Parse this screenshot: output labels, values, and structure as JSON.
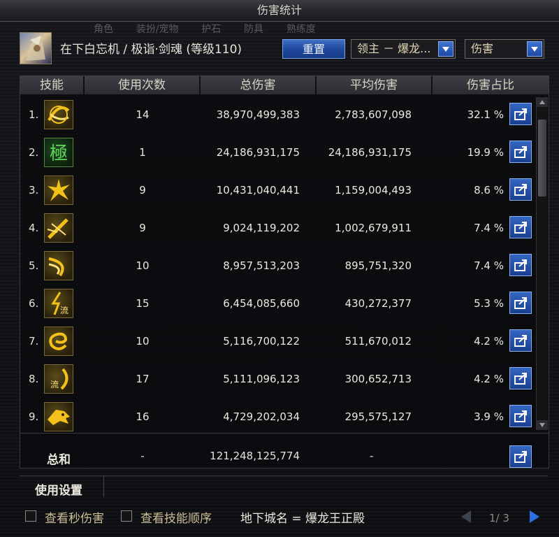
{
  "window": {
    "title": "伤害统计"
  },
  "background_tabs": [
    "角色",
    "装扮/宠物",
    "护石",
    "防具",
    "熟练度"
  ],
  "header": {
    "character": "在下白忘机 / 极诣·剑魂 (等级110)",
    "reset_label": "重置",
    "target_select": "领主 － 爆龙...",
    "metric_select": "伤害"
  },
  "columns": [
    "技能",
    "使用次数",
    "总伤害",
    "平均伤害",
    "伤害占比"
  ],
  "rows": [
    {
      "index": "1.",
      "uses": "14",
      "total": "38,970,499,383",
      "avg": "2,783,607,098",
      "pct": "32.1 %"
    },
    {
      "index": "2.",
      "uses": "1",
      "total": "24,186,931,175",
      "avg": "24,186,931,175",
      "pct": "19.9 %"
    },
    {
      "index": "3.",
      "uses": "9",
      "total": "10,431,040,441",
      "avg": "1,159,004,493",
      "pct": "8.6 %"
    },
    {
      "index": "4.",
      "uses": "9",
      "total": "9,024,119,202",
      "avg": "1,002,679,911",
      "pct": "7.4 %"
    },
    {
      "index": "5.",
      "uses": "10",
      "total": "8,957,513,203",
      "avg": "895,751,320",
      "pct": "7.4 %"
    },
    {
      "index": "6.",
      "uses": "15",
      "total": "6,454,085,660",
      "avg": "430,272,377",
      "pct": "5.3 %"
    },
    {
      "index": "7.",
      "uses": "10",
      "total": "5,116,700,122",
      "avg": "511,670,012",
      "pct": "4.2 %"
    },
    {
      "index": "8.",
      "uses": "17",
      "total": "5,111,096,123",
      "avg": "300,652,713",
      "pct": "4.2 %"
    },
    {
      "index": "9.",
      "uses": "16",
      "total": "4,729,202,034",
      "avg": "295,575,127",
      "pct": "3.9 %"
    }
  ],
  "sum": {
    "label": "总和",
    "uses": "-",
    "total": "121,248,125,774",
    "avg": "-"
  },
  "settings": {
    "label": "使用设置"
  },
  "footer": {
    "check_dps": "查看秒伤害",
    "check_order": "查看技能顺序",
    "dungeon": "地下城名 = 爆龙王正殿",
    "page": "1/ 3"
  },
  "colors": {
    "accent_blue": "#2f6ee0",
    "gold_icon": "#f2c21a",
    "green_icon": "#5fd35a",
    "panel_bg": "#0d0e12"
  }
}
